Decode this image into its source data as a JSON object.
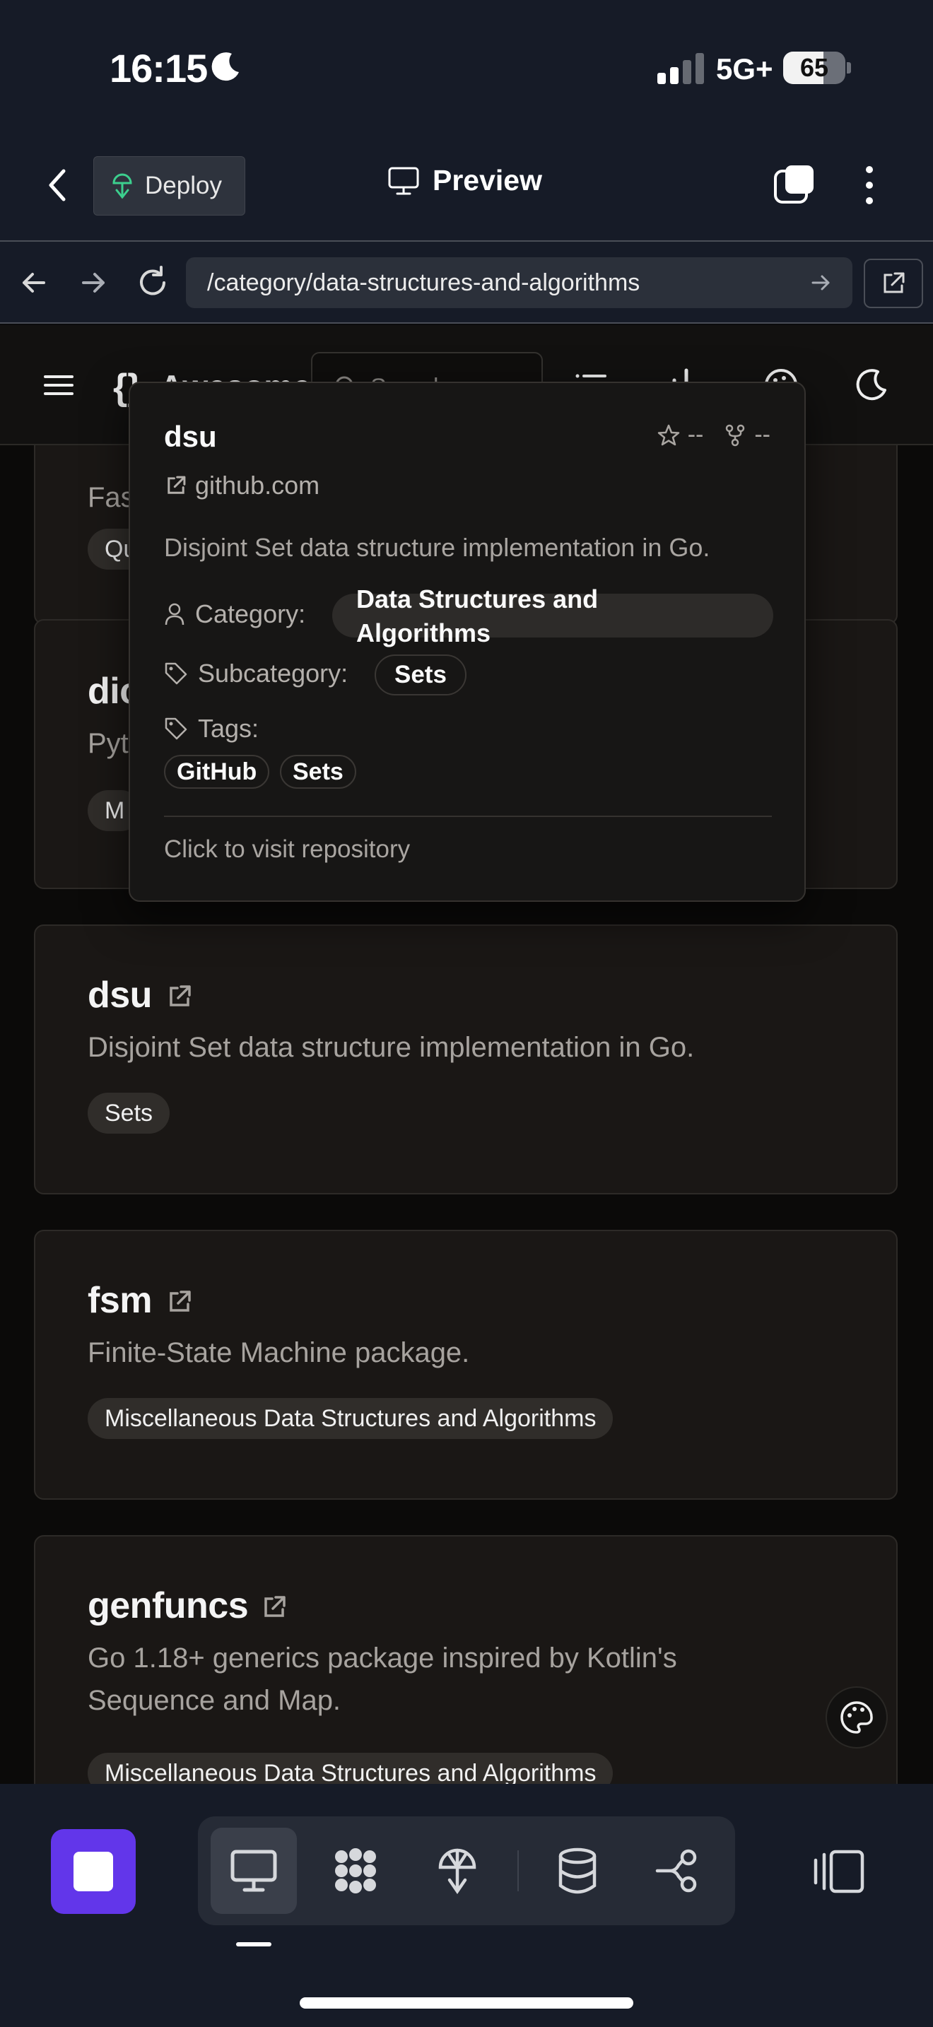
{
  "status_bar": {
    "time": "16:15",
    "network": "5G+",
    "battery": "65",
    "battery_level": 0.65
  },
  "app_bar": {
    "deploy_label": "Deploy",
    "preview_label": "Preview"
  },
  "browser": {
    "url": "/category/data-structures-and-algorithms"
  },
  "site": {
    "brand": "Awesome",
    "search_placeholder": "Search"
  },
  "cards": [
    {
      "title": "",
      "desc": "Fas",
      "chip": "Qu"
    },
    {
      "title": "dic",
      "desc": "Pyt",
      "chip": "M"
    },
    {
      "title": "dsu",
      "desc": "Disjoint Set data structure implementation in Go.",
      "chip": "Sets"
    },
    {
      "title": "fsm",
      "desc": "Finite-State Machine package.",
      "chip": "Miscellaneous Data Structures and Algorithms"
    },
    {
      "title": "genfuncs",
      "desc": "Go 1.18+ generics package inspired by Kotlin's Sequence and Map.",
      "chip": "Miscellaneous Data Structures and Algorithms"
    }
  ],
  "popover": {
    "title": "dsu",
    "stars": "--",
    "forks": "--",
    "domain": "github.com",
    "description": "Disjoint Set data structure implementation in Go.",
    "category_label": "Category:",
    "category_value": "Data Structures and Algorithms",
    "subcategory_label": "Subcategory:",
    "subcategory_value": "Sets",
    "tags_label": "Tags:",
    "tags": [
      "GitHub",
      "Sets"
    ],
    "footer": "Click to visit repository"
  },
  "colors": {
    "accent": "#6236ea",
    "chrome_bg": "#161b27",
    "card_bg": "#1a1715"
  }
}
